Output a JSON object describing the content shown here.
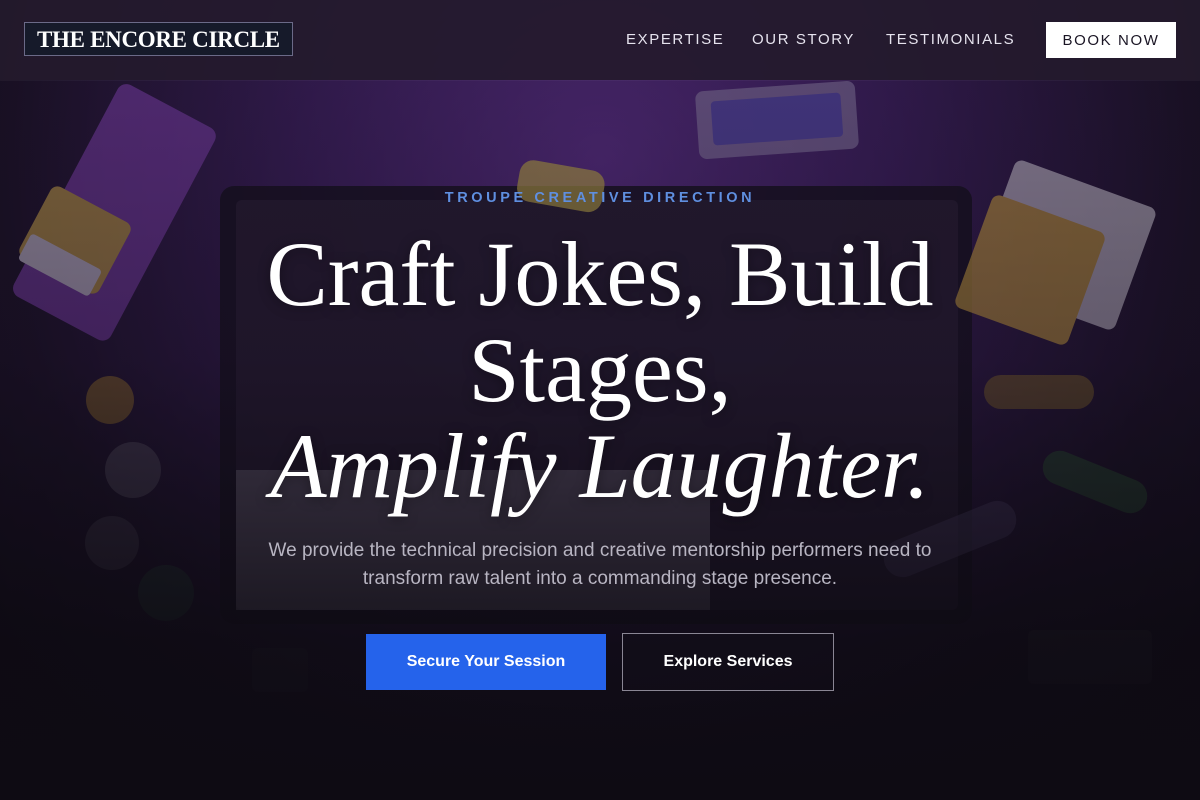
{
  "brand": {
    "logo_text": "THE ENCORE CIRCLE"
  },
  "nav": {
    "links": [
      "EXPERTISE",
      "OUR STORY",
      "TESTIMONIALS"
    ],
    "cta_label": "BOOK NOW"
  },
  "hero": {
    "eyebrow": "TROUPE CREATIVE DIRECTION",
    "headline_line1": "Craft Jokes, Build",
    "headline_line2": "Stages,",
    "headline_line3": "Amplify Laughter.",
    "subtitle": "We provide the technical precision and creative mentorship performers need to transform raw talent into a commanding stage presence.",
    "primary_button": "Secure Your Session",
    "secondary_button": "Explore Services"
  },
  "colors": {
    "accent": "#2563eb",
    "eyebrow": "#5f8fe0",
    "navbar": "#241a2c",
    "hero_purple": "#5a2f86"
  }
}
